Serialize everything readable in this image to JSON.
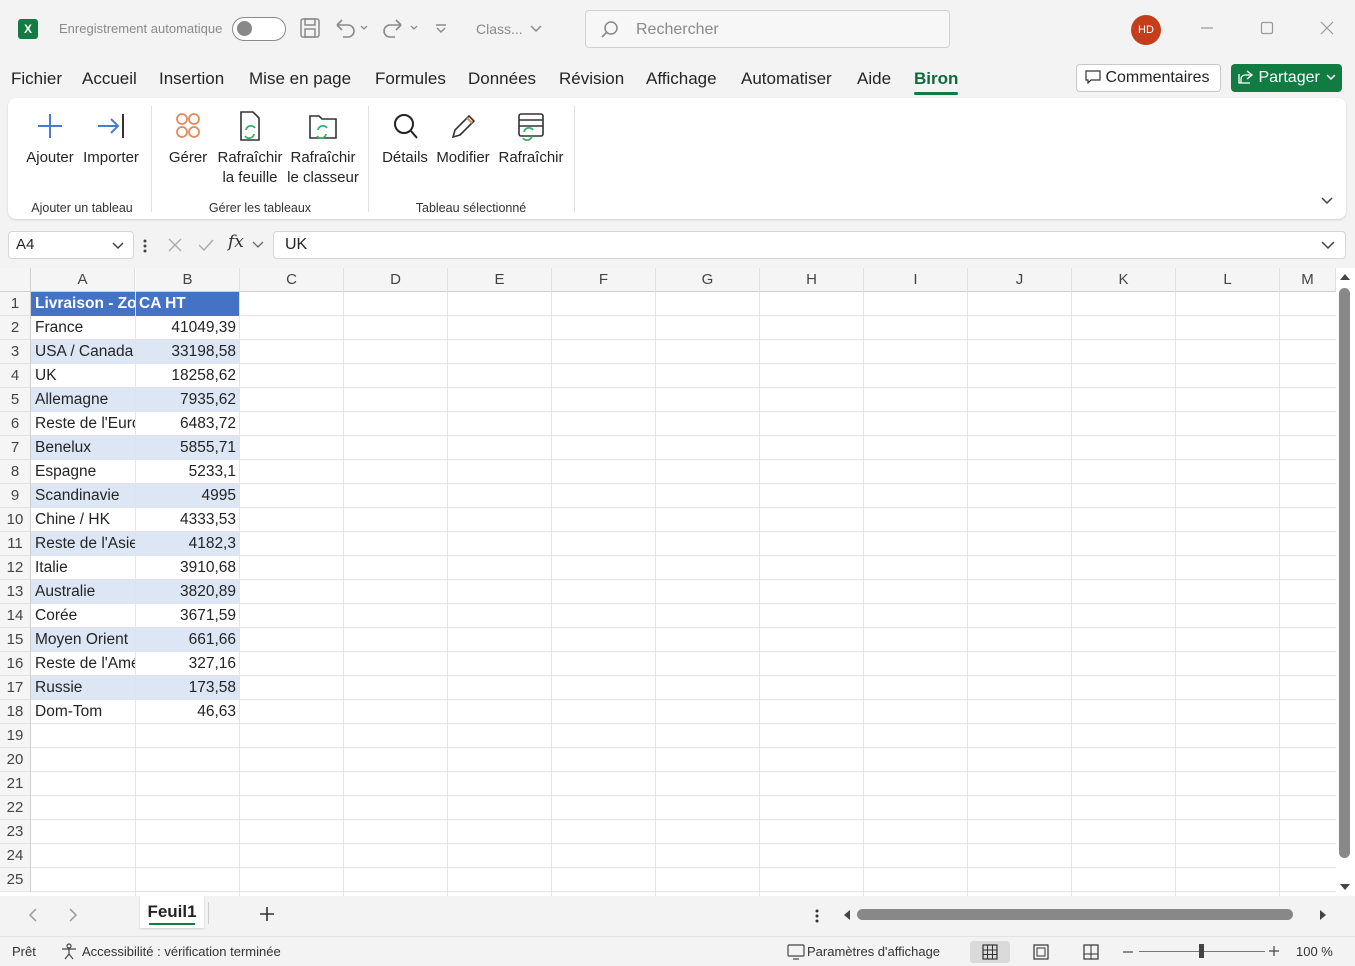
{
  "titlebar": {
    "app_logo": "X",
    "autosave_label": "Enregistrement automatique",
    "doc_name": "Class...",
    "search_placeholder": "Rechercher",
    "user_initials": "HD"
  },
  "menu": {
    "items": [
      "Fichier",
      "Accueil",
      "Insertion",
      "Mise en page",
      "Formules",
      "Données",
      "Révision",
      "Affichage",
      "Automatiser",
      "Aide",
      "Biron"
    ],
    "active": "Biron",
    "comments_label": "Commentaires",
    "share_label": "Partager"
  },
  "ribbon": {
    "groups": [
      {
        "label": "Ajouter un tableau",
        "buttons": [
          "Ajouter",
          "Importer"
        ]
      },
      {
        "label": "Gérer les tableaux",
        "buttons": [
          "Gérer",
          "Rafraîchir la feuille",
          "Rafraîchir le classeur"
        ]
      },
      {
        "label": "Tableau sélectionné",
        "buttons": [
          "Détails",
          "Modifier",
          "Rafraîchir"
        ]
      }
    ],
    "btn": {
      "ajouter": "Ajouter",
      "importer": "Importer",
      "gerer": "Gérer",
      "rafraichir_feuille_1": "Rafraîchir",
      "rafraichir_feuille_2": "la feuille",
      "rafraichir_classeur_1": "Rafraîchir",
      "rafraichir_classeur_2": "le classeur",
      "details": "Détails",
      "modifier": "Modifier",
      "rafraichir": "Rafraîchir"
    },
    "group_labels": {
      "g1": "Ajouter un tableau",
      "g2": "Gérer les tableaux",
      "g3": "Tableau sélectionné"
    }
  },
  "formula_bar": {
    "name_box": "A4",
    "fx": "fx",
    "content": "UK"
  },
  "sheet": {
    "columns": [
      "A",
      "B",
      "C",
      "D",
      "E",
      "F",
      "G",
      "H",
      "I",
      "J",
      "K",
      "L",
      "M"
    ],
    "row_numbers": [
      "1",
      "2",
      "3",
      "4",
      "5",
      "6",
      "7",
      "8",
      "9",
      "10",
      "11",
      "12",
      "13",
      "14",
      "15",
      "16",
      "17",
      "18",
      "19",
      "20",
      "21",
      "22",
      "23",
      "24",
      "25"
    ],
    "header": [
      "Livraison - Zone",
      "CA HT"
    ],
    "rows": [
      [
        "France",
        "41049,39"
      ],
      [
        "USA / Canada",
        "33198,58"
      ],
      [
        "UK",
        "18258,62"
      ],
      [
        "Allemagne",
        "7935,62"
      ],
      [
        "Reste de l'Europe",
        "6483,72"
      ],
      [
        "Benelux",
        "5855,71"
      ],
      [
        "Espagne",
        "5233,1"
      ],
      [
        "Scandinavie",
        "4995"
      ],
      [
        "Chine / HK",
        "4333,53"
      ],
      [
        "Reste de l'Asie",
        "4182,3"
      ],
      [
        "Italie",
        "3910,68"
      ],
      [
        "Australie",
        "3820,89"
      ],
      [
        "Corée",
        "3671,59"
      ],
      [
        "Moyen Orient",
        "661,66"
      ],
      [
        "Reste de l'Amérique",
        "327,16"
      ],
      [
        "Russie",
        "173,58"
      ],
      [
        "Dom-Tom",
        "46,63"
      ]
    ]
  },
  "tabs": {
    "sheet_name": "Feuil1"
  },
  "status": {
    "ready": "Prêt",
    "accessibility": "Accessibilité : vérification terminée",
    "display_settings": "Paramètres d'affichage",
    "zoom": "100 %"
  },
  "colors": {
    "accent": "#107c41",
    "table_header": "#4472c4",
    "table_band": "#dde6f5",
    "avatar": "#c43e1c"
  }
}
